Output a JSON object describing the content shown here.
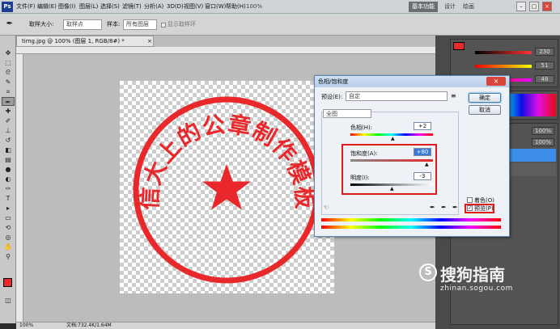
{
  "appbar": {
    "logo": "Ps",
    "menu": [
      "文件(F)",
      "编辑(E)",
      "图像(I)",
      "图层(L)",
      "选择(S)",
      "滤镜(T)",
      "分析(A)",
      "3D(D)",
      "视图(V)",
      "窗口(W)",
      "帮助(H)"
    ],
    "zoom": "100%",
    "workspaces": [
      "基本功能",
      "设计",
      "绘画"
    ],
    "active_workspace": "基本功能"
  },
  "options": {
    "sample_size_label": "取样大小:",
    "sample_size_value": "取样点",
    "sample_label": "样本:",
    "sample_value": "所有图层",
    "show_ring": "显示取样环"
  },
  "document": {
    "tab_title": "timg.jpg @ 100% (图层 1, RGB/8#) *",
    "status_zoom": "100%",
    "status_doc": "文档:732.4K/1.64M"
  },
  "stamp": {
    "text": "信大上的公章制作模板",
    "color": "#e8282a"
  },
  "dialog": {
    "title": "色相/饱和度",
    "preset_label": "预设(E):",
    "preset_value": "自定",
    "ok": "确定",
    "cancel": "取消",
    "channel": "全图",
    "hue_label": "色相(H):",
    "hue_value": "+2",
    "saturation_label": "饱和度(A):",
    "saturation_value": "+80",
    "lightness_label": "明度(I):",
    "lightness_value": "-3",
    "colorize_label": "着色(O)",
    "preview_label": "预览(P)",
    "preview_checked": true
  },
  "color_panel": {
    "r": "230",
    "g": "51",
    "b": "48"
  },
  "layers_panel": {
    "opacity": "100%",
    "fill": "100%"
  },
  "watermark": {
    "logo": "S",
    "brand": "搜狗指南",
    "url": "zhinan.sogou.com"
  }
}
